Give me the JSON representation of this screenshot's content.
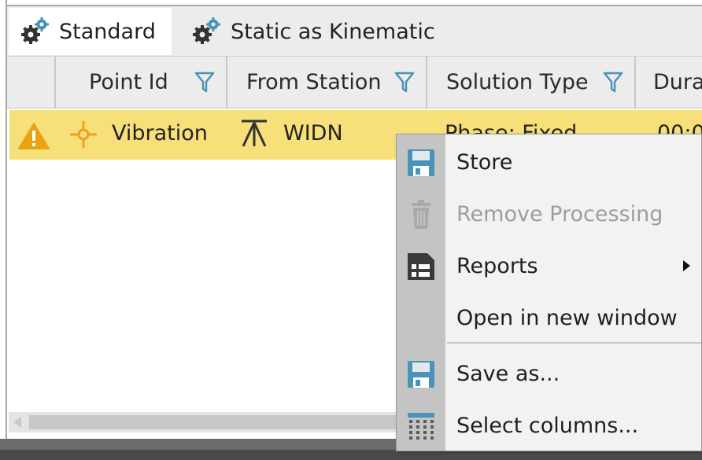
{
  "tabs": [
    {
      "label": "Standard",
      "icon": "gears-icon",
      "active": true
    },
    {
      "label": "Static as Kinematic",
      "icon": "gears-icon",
      "active": false
    }
  ],
  "columns": [
    {
      "label": ""
    },
    {
      "label": "Point Id",
      "icon": "filter-icon"
    },
    {
      "label": "From Station",
      "icon": "filter-icon"
    },
    {
      "label": "Solution Type",
      "icon": "filter-icon"
    },
    {
      "label": "Dura"
    }
  ],
  "row": {
    "status_icon": "warning-icon",
    "point_icon": "point-target-icon",
    "point_id": "Vibration",
    "station_icon": "tripod-icon",
    "from_station": "WIDN",
    "solution_type": "Phase: Fixed",
    "duration": "00:0"
  },
  "context_menu": {
    "items": [
      {
        "label": "Store",
        "icon": "save-icon",
        "enabled": true
      },
      {
        "label": "Remove Processing",
        "icon": "trash-icon",
        "enabled": false
      },
      {
        "label": "Reports",
        "icon": "report-icon",
        "enabled": true,
        "submenu": true
      },
      {
        "label": "Open in new window",
        "icon": "",
        "enabled": true
      },
      {
        "label": "Save as...",
        "icon": "save-as-icon",
        "enabled": true
      },
      {
        "label": "Select columns...",
        "icon": "columns-icon",
        "enabled": true
      }
    ]
  },
  "colors": {
    "selected_row": "#f7e07a",
    "accent_blue": "#4a93b8",
    "warning": "#e8a317",
    "point_orange": "#f0a020"
  }
}
